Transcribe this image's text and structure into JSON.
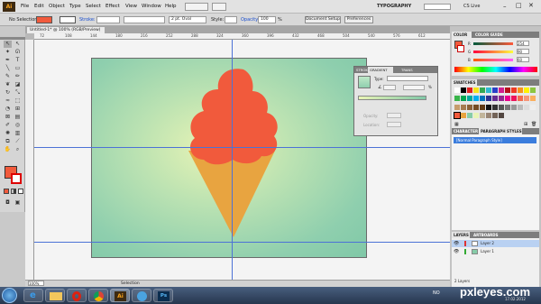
{
  "app": {
    "logo": "Ai",
    "workspace": "TYPOGRAPHY",
    "cslive": "CS Live"
  },
  "menu": [
    "File",
    "Edit",
    "Object",
    "Type",
    "Select",
    "Effect",
    "View",
    "Window",
    "Help"
  ],
  "control": {
    "selection": "No Selection",
    "stroke_label": "Stroke:",
    "brush": "2 pt. Oval",
    "style_label": "Style:",
    "opacity_label": "Opacity:",
    "opacity_value": "100",
    "opacity_unit": "%",
    "doc_setup": "Document Setup",
    "preferences": "Preferences"
  },
  "document": {
    "tab": "Untitled-1* @ 100% (RGB/Preview)",
    "zoom": "100%",
    "status": "Selection",
    "ruler_marks": [
      "72",
      "108",
      "144",
      "180",
      "216",
      "252",
      "288",
      "324",
      "360",
      "396",
      "432",
      "468",
      "504",
      "540",
      "576",
      "612"
    ]
  },
  "colors": {
    "artboard_green": "#86cca8",
    "scoop": "#f15a3c",
    "cone": "#e8a440",
    "guide": "#4c72d6",
    "fill_swatch": "#f15a3c"
  },
  "color_panel": {
    "tabs": [
      "COLOR",
      "COLOR GUIDE"
    ],
    "r": "254",
    "g": "90",
    "b": "60",
    "r_label": "R",
    "g_label": "G",
    "b_label": "B"
  },
  "swatches_panel": {
    "tab": "SWATCHES"
  },
  "char_panel": {
    "tabs": [
      "CHARACTER",
      "PARAGRAPH STYLES"
    ],
    "item": "[Normal Paragraph Style]"
  },
  "gradient_panel": {
    "tabs": [
      "STROKE",
      "GRADIENT",
      "TRANS"
    ],
    "type_label": "Type:",
    "opacity_label": "Opacity:",
    "location_label": "Location:",
    "pct": "%"
  },
  "layers_panel": {
    "tabs": [
      "LAYERS",
      "ARTBOARDS"
    ],
    "layers": [
      "Layer 2",
      "Layer 1"
    ],
    "count": "2 Layers"
  },
  "taskbar": {
    "apps": [
      "ie",
      "folder",
      "opera",
      "chrome",
      "illustrator",
      "itunes",
      "photoshop"
    ],
    "lang": "NO",
    "watermark": "pxleyes.com",
    "date": "17.02.2012"
  }
}
